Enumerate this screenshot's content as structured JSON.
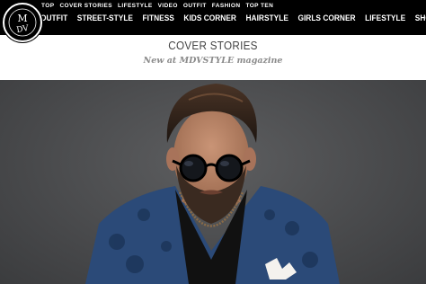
{
  "site": {
    "logo_text": "MDV"
  },
  "nav": {
    "secondary": [
      "TOP",
      "COVER STORIES",
      "LIFESTYLE",
      "VIDEO",
      "OUTFIT",
      "FASHION",
      "TOP TEN"
    ],
    "primary": [
      "OUTFIT",
      "STREET-STYLE",
      "FITNESS",
      "KIDS CORNER",
      "HAIRSTYLE",
      "GIRLS CORNER",
      "LIFESTYLE",
      "SHOP"
    ]
  },
  "page": {
    "title": "COVER STORIES",
    "subtitle": "New at MDVSTYLE magazine"
  },
  "colors": {
    "nav_bg": "#000000",
    "hero_bg": "#4c4d4f",
    "jacket": "#2a4773"
  }
}
